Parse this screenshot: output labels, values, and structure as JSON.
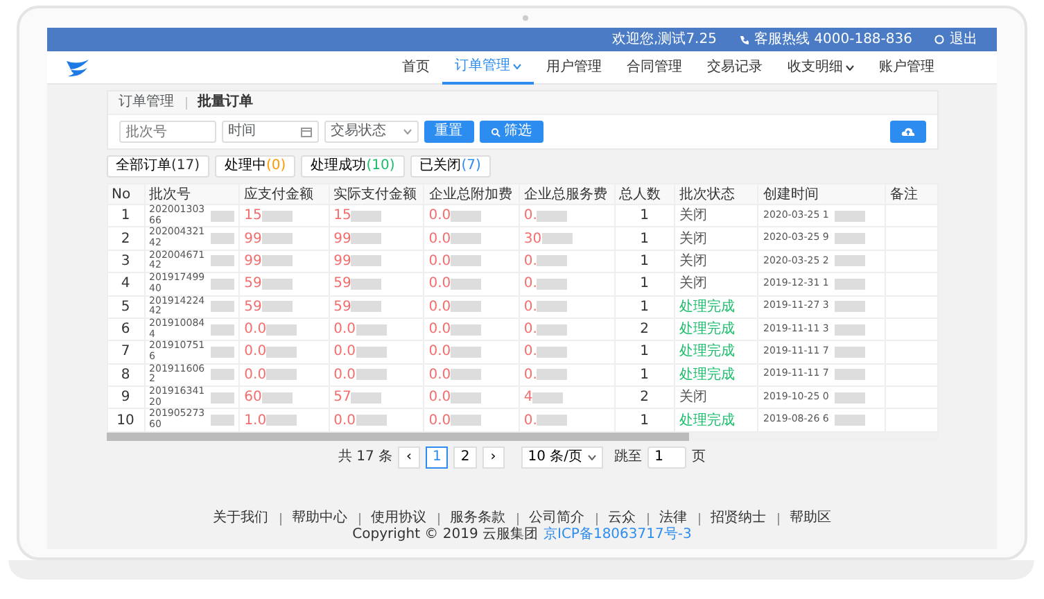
{
  "top_bar": {
    "welcome": "欢迎您,测试7.25",
    "hotline": "客服热线 4000-188-836",
    "logout": "退出"
  },
  "nav": [
    {
      "label": "首页",
      "selected": false,
      "dropdown": false
    },
    {
      "label": "订单管理",
      "selected": true,
      "dropdown": true
    },
    {
      "label": "用户管理",
      "selected": false,
      "dropdown": false
    },
    {
      "label": "合同管理",
      "selected": false,
      "dropdown": false
    },
    {
      "label": "交易记录",
      "selected": false,
      "dropdown": false
    },
    {
      "label": "收支明细",
      "selected": false,
      "dropdown": true
    },
    {
      "label": "账户管理",
      "selected": false,
      "dropdown": false
    }
  ],
  "breadcrumb": [
    "订单管理",
    "批量订单"
  ],
  "filters": {
    "batch_placeholder": "批次号",
    "time_placeholder": "时间",
    "status_placeholder": "交易状态",
    "reset": "重置",
    "search": "筛选"
  },
  "tabs": [
    {
      "label": "全部订单",
      "count": "(17)",
      "color": "#333333"
    },
    {
      "label": "处理中",
      "count": "(0)",
      "color": "#ff9900"
    },
    {
      "label": "处理成功",
      "count": "(10)",
      "color": "#19be6b"
    },
    {
      "label": "已关闭",
      "count": "(7)",
      "color": "#2d8cf0"
    }
  ],
  "table": {
    "columns": [
      "No",
      "批次号",
      "应支付金额",
      "实际支付金额",
      "企业总附加费",
      "企业总服务费",
      "总人数",
      "批次状态",
      "创建时间",
      "备注"
    ],
    "rows": [
      {
        "no": "1",
        "batch": "202001303 66",
        "due": "15",
        "paid": "15",
        "fee_a": "0.0",
        "fee_b": "0.",
        "count": "1",
        "status": "关闭",
        "kind": "closed",
        "created": "2020-03-25 1"
      },
      {
        "no": "2",
        "batch": "202004321 42",
        "due": "99",
        "paid": "99",
        "fee_a": "0.0",
        "fee_b": "30",
        "count": "1",
        "status": "关闭",
        "kind": "closed",
        "created": "2020-03-25 9"
      },
      {
        "no": "3",
        "batch": "202004671 42",
        "due": "99",
        "paid": "99",
        "fee_a": "0.0",
        "fee_b": "0.",
        "count": "1",
        "status": "关闭",
        "kind": "closed",
        "created": "2020-03-25 2"
      },
      {
        "no": "4",
        "batch": "201917499 40",
        "due": "59",
        "paid": "59",
        "fee_a": "0.0",
        "fee_b": "0.",
        "count": "1",
        "status": "关闭",
        "kind": "closed",
        "created": "2019-12-31 1"
      },
      {
        "no": "5",
        "batch": "201914224 42",
        "due": "59",
        "paid": "59",
        "fee_a": "0.0",
        "fee_b": "0.",
        "count": "1",
        "status": "处理完成",
        "kind": "done",
        "created": "2019-11-27 3"
      },
      {
        "no": "6",
        "batch": "201910084 4",
        "due": "0.0",
        "paid": "0.0",
        "fee_a": "0.0",
        "fee_b": "0.",
        "count": "2",
        "status": "处理完成",
        "kind": "done",
        "created": "2019-11-11 3"
      },
      {
        "no": "7",
        "batch": "201910751 6",
        "due": "0.0",
        "paid": "0.0",
        "fee_a": "0.0",
        "fee_b": "0.",
        "count": "1",
        "status": "处理完成",
        "kind": "done",
        "created": "2019-11-11 7"
      },
      {
        "no": "8",
        "batch": "201911606 2",
        "due": "0.0",
        "paid": "0.0",
        "fee_a": "0.0",
        "fee_b": "0.",
        "count": "1",
        "status": "处理完成",
        "kind": "done",
        "created": "2019-11-11 7"
      },
      {
        "no": "9",
        "batch": "201916341 20",
        "due": "60",
        "paid": "57",
        "fee_a": "0.0",
        "fee_b": "4",
        "count": "2",
        "status": "关闭",
        "kind": "closed",
        "created": "2019-10-25 0"
      },
      {
        "no": "10",
        "batch": "201905273 60",
        "due": "1.0",
        "paid": "0.0",
        "fee_a": "0.0",
        "fee_b": "0.",
        "count": "1",
        "status": "处理完成",
        "kind": "done",
        "created": "2019-08-26 6"
      }
    ]
  },
  "pagination": {
    "total": "共 17 条",
    "prev": "‹",
    "pages": [
      {
        "label": "1",
        "selected": true
      },
      {
        "label": "2",
        "selected": false
      }
    ],
    "next": "›",
    "page_size": "10 条/页",
    "jump": "跳至",
    "jump_value": "1",
    "page_suffix": "页"
  },
  "footer": {
    "links": [
      "关于我们",
      "帮助中心",
      "使用协议",
      "服务条款",
      "公司简介",
      "云众",
      "法律",
      "招贤纳士",
      "帮助区"
    ],
    "copyright": "Copyright © 2019 云服集团",
    "icp": "京ICP备18063717号-3"
  }
}
